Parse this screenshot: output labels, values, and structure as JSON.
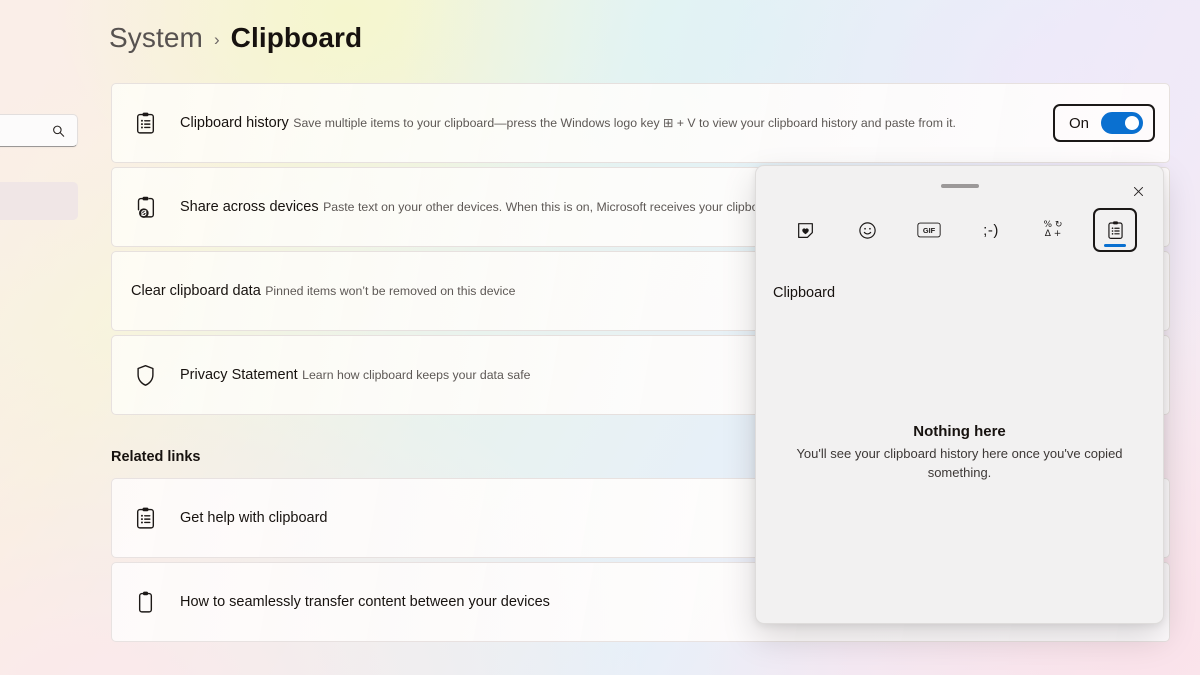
{
  "breadcrumb": {
    "parent": "System",
    "separator": "›",
    "current": "Clipboard"
  },
  "nav": {
    "search_placeholder": "",
    "search_icon": "search-icon"
  },
  "settings": {
    "items": [
      {
        "icon": "clipboard-list-icon",
        "title": "Clipboard history",
        "desc": "Save multiple items to your clipboard—press the Windows logo key ⊞ + V to view your clipboard history and paste from it.",
        "toggle": {
          "label": "On",
          "state": "on",
          "accent": "#0a70d0"
        }
      },
      {
        "icon": "clipboard-sync-icon",
        "title": "Share across devices",
        "desc": "Paste text on your other devices. When this is on, Microsoft receives your clipboard data to sy"
      },
      {
        "icon": "",
        "title": "Clear clipboard data",
        "desc": "Pinned items won’t be removed on this device"
      },
      {
        "icon": "shield-icon",
        "title": "Privacy Statement",
        "desc": "Learn how clipboard keeps your data safe"
      }
    ]
  },
  "related": {
    "heading": "Related links",
    "links": [
      {
        "icon": "clipboard-list-icon",
        "title": "Get help with clipboard"
      },
      {
        "icon": "clipboard-plain-icon",
        "title": "How to seamlessly transfer content between your devices"
      }
    ]
  },
  "flyout": {
    "close_icon": "close-icon",
    "grabber": "drag-handle",
    "tabs": [
      {
        "name": "recent-stickers-tab",
        "icon": "sticker-heart-icon",
        "selected": false
      },
      {
        "name": "emoji-tab",
        "icon": "smiley-icon",
        "selected": false
      },
      {
        "name": "gif-tab",
        "icon": "gif-icon",
        "label": "GIF",
        "selected": false
      },
      {
        "name": "kaomoji-tab",
        "icon": "kaomoji-icon",
        "label": ";-)",
        "selected": false
      },
      {
        "name": "symbols-tab",
        "icon": "symbols-icon",
        "label_top": "% ↻",
        "label_bottom": "Δ +",
        "selected": false
      },
      {
        "name": "clipboard-tab",
        "icon": "clipboard-list-icon",
        "selected": true
      }
    ],
    "heading": "Clipboard",
    "empty_title": "Nothing here",
    "empty_subtitle": "You'll see your clipboard history here once you've copied something."
  }
}
